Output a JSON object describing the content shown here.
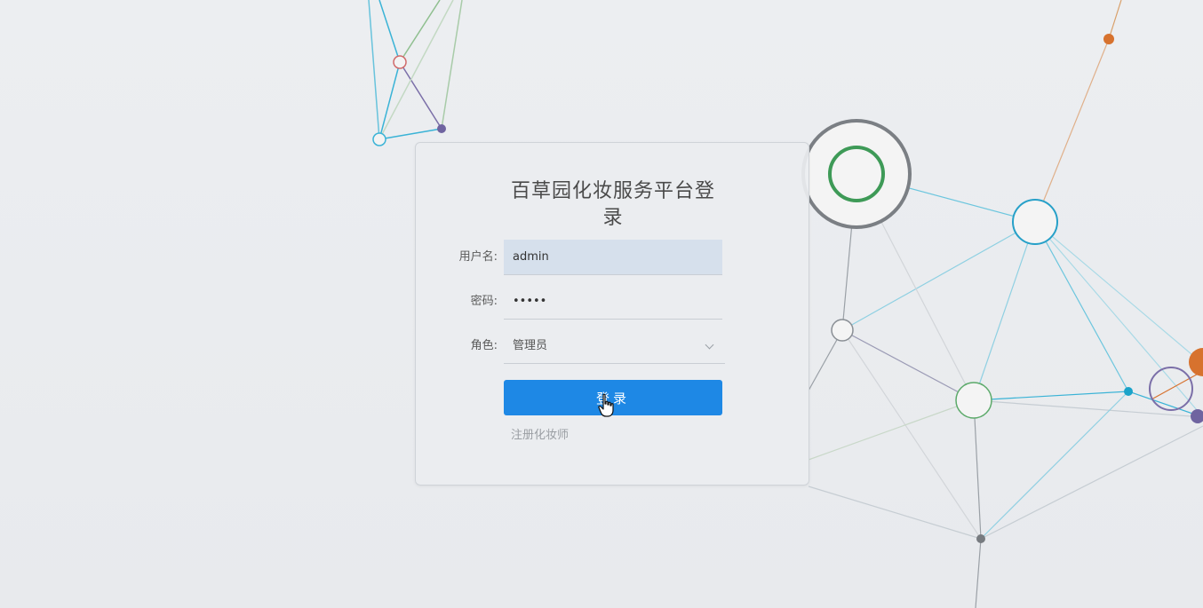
{
  "login": {
    "title": "百草园化妆服务平台登录",
    "username_label": "用户名:",
    "username_value": "admin",
    "password_label": "密码:",
    "password_value": "•••••",
    "role_label": "角色:",
    "role_selected": "管理员",
    "submit_label": "登录",
    "register_link": "注册化妆师"
  },
  "icons": {
    "role_dropdown": "chevron-down-icon",
    "cursor": "hand-pointer-icon"
  },
  "colors": {
    "primary_button": "#1e88e5",
    "username_field_bg": "#d6e0ec",
    "page_background": "#e9ebee"
  }
}
